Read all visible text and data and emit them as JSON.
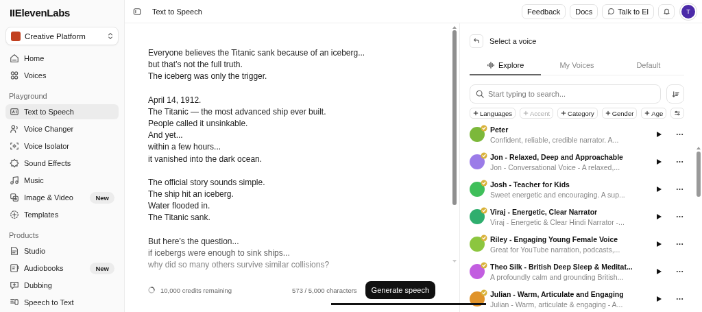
{
  "logo": "IIElevenLabs",
  "workspace": {
    "label": "Creative Platform"
  },
  "sidebar": {
    "sections": [
      {
        "items": [
          {
            "label": "Home",
            "selected": false
          },
          {
            "label": "Voices",
            "selected": false
          }
        ]
      },
      {
        "heading": "Playground",
        "items": [
          {
            "label": "Text to Speech",
            "selected": true
          },
          {
            "label": "Voice Changer",
            "selected": false
          },
          {
            "label": "Voice Isolator",
            "selected": false
          },
          {
            "label": "Sound Effects",
            "selected": false
          },
          {
            "label": "Music",
            "selected": false
          },
          {
            "label": "Image & Video",
            "selected": false,
            "badge": "New"
          },
          {
            "label": "Templates",
            "selected": false
          }
        ]
      },
      {
        "heading": "Products",
        "items": [
          {
            "label": "Studio",
            "selected": false
          },
          {
            "label": "Audiobooks",
            "selected": false,
            "badge": "New"
          },
          {
            "label": "Dubbing",
            "selected": false
          },
          {
            "label": "Speech to Text",
            "selected": false
          }
        ]
      }
    ]
  },
  "header": {
    "title": "Text to Speech",
    "buttons": [
      "Feedback",
      "Docs",
      "Talk to El"
    ],
    "avatar": "T"
  },
  "editor": {
    "paragraphs": [
      [
        "Everyone believes the Titanic sank because of an iceberg...",
        "but that’s not the full truth.",
        "The iceberg was only the trigger."
      ],
      [
        "April 14, 1912.",
        "The Titanic — the most advanced ship ever built.",
        "People called it unsinkable.",
        "And yet...",
        "within a few hours...",
        "it vanished into the dark ocean."
      ],
      [
        "The official story sounds simple.",
        "The ship hit an iceberg.",
        "Water flooded in.",
        "The Titanic sank."
      ],
      [
        "But here’s the question...",
        "if icebergs were enough to sink ships...",
        "why did so many others survive similar collisions?"
      ]
    ],
    "credits": "10,000 credits remaining",
    "count": "573 / 5,000 characters",
    "generate": "Generate speech"
  },
  "voice_panel": {
    "title": "Select a voice",
    "tabs": [
      {
        "label": "Explore",
        "selected": true
      },
      {
        "label": "My Voices",
        "selected": false
      },
      {
        "label": "Default",
        "selected": false
      }
    ],
    "search": {
      "placeholder": "Start typing to search..."
    },
    "filters": [
      {
        "label": "Languages",
        "disabled": false
      },
      {
        "label": "Accent",
        "disabled": true
      },
      {
        "label": "Category",
        "disabled": false
      },
      {
        "label": "Gender",
        "disabled": false
      },
      {
        "label": "Age",
        "disabled": false
      }
    ],
    "voices": [
      {
        "name": "Peter",
        "description": "Confident, reliable, credible narrator. A...",
        "color": "#7cb83a"
      },
      {
        "name": "Jon - Relaxed, Deep and Approachable",
        "description": "Jon - Conversational Voice - A relaxed,...",
        "color": "#9b7be8"
      },
      {
        "name": "Josh - Teacher for Kids",
        "description": "Sweet energetic and encouraging. A sup...",
        "color": "#3fbf5a"
      },
      {
        "name": "Viraj - Energetic, Clear Narrator",
        "description": "Viraj - Energetic & Clear Hindi Narrator -...",
        "color": "#2fae6e"
      },
      {
        "name": "Riley - Engaging Young Female Voice",
        "description": "Great for YouTube narration, podcasts,...",
        "color": "#8cc63f"
      },
      {
        "name": "Theo Silk - British Deep Sleep & Meditat...",
        "description": "A profoundly calm and grounding British...",
        "color": "#c25ee0"
      },
      {
        "name": "Julian - Warm, Articulate and Engaging",
        "description": "Julian - Warm, articulate & engaging - A...",
        "color": "#e0932a"
      }
    ]
  }
}
